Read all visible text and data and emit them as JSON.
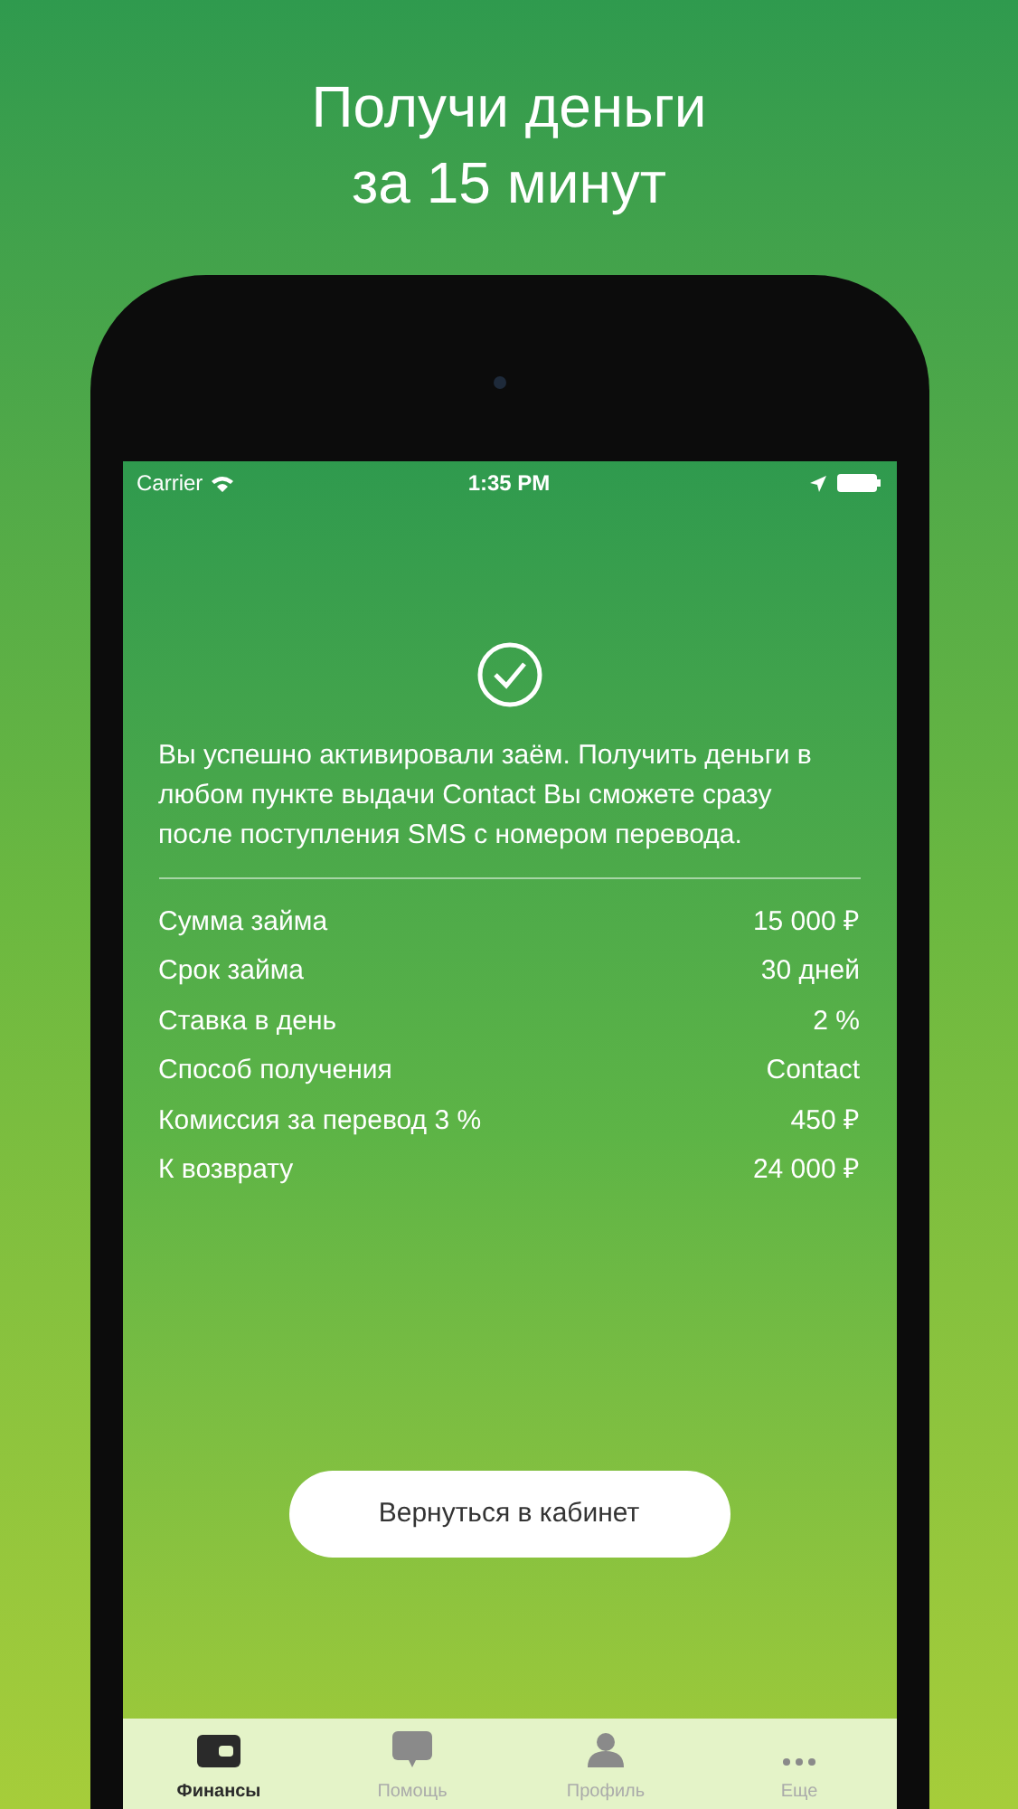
{
  "headline": [
    "Получи деньги",
    "за 15 минут"
  ],
  "status_bar": {
    "carrier": "Carrier",
    "time": "1:35 PM"
  },
  "message": "Вы успешно активировали заём. Получить деньги в любом пункте выдачи Contact Вы сможете сразу после поступления SMS с номером перевода.",
  "details": [
    {
      "label": "Сумма займа",
      "value": "15 000 ₽"
    },
    {
      "label": "Срок займа",
      "value": "30 дней"
    },
    {
      "label": "Ставка в день",
      "value": "2 %"
    },
    {
      "label": "Способ получения",
      "value": "Contact"
    },
    {
      "label": "Комиссия за перевод 3 %",
      "value": "450 ₽"
    },
    {
      "label": "К возврату",
      "value": "24 000 ₽"
    }
  ],
  "button": "Вернуться в кабинет",
  "tabs": [
    {
      "label": "Финансы",
      "kind": "wallet",
      "selected": true
    },
    {
      "label": "Помощь",
      "kind": "chat",
      "selected": false
    },
    {
      "label": "Профиль",
      "kind": "person",
      "selected": false
    },
    {
      "label": "Еще",
      "kind": "more",
      "selected": false
    }
  ]
}
